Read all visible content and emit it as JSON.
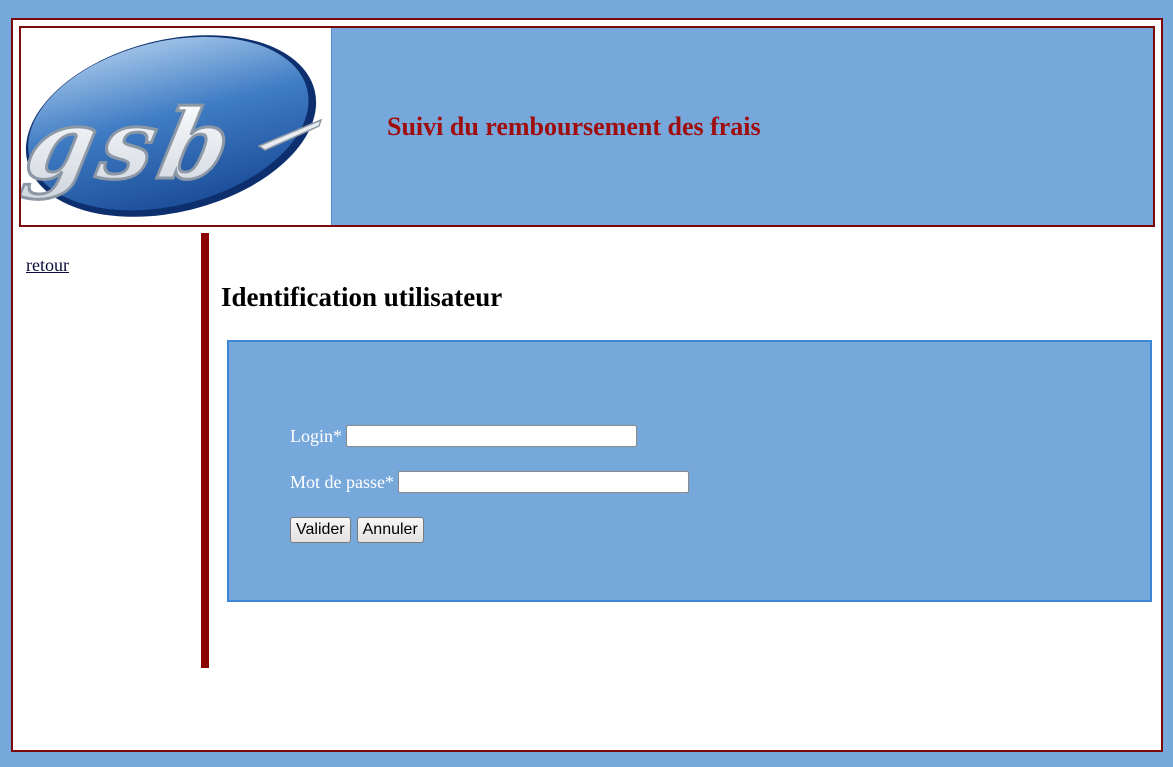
{
  "header": {
    "logo_text": "gsb",
    "title": "Suivi du remboursement des frais"
  },
  "sidebar": {
    "back_link": "retour"
  },
  "main": {
    "title": "Identification utilisateur",
    "form": {
      "login_label": "Login*",
      "login_value": "",
      "password_label": "Mot de passe*",
      "password_value": "",
      "submit_label": "Valider",
      "reset_label": "Annuler"
    }
  },
  "colors": {
    "background": "#77a8dc",
    "accent_dark_red": "#8b0000",
    "title_red": "#a00d0d",
    "panel_blue": "#77a8dc"
  }
}
